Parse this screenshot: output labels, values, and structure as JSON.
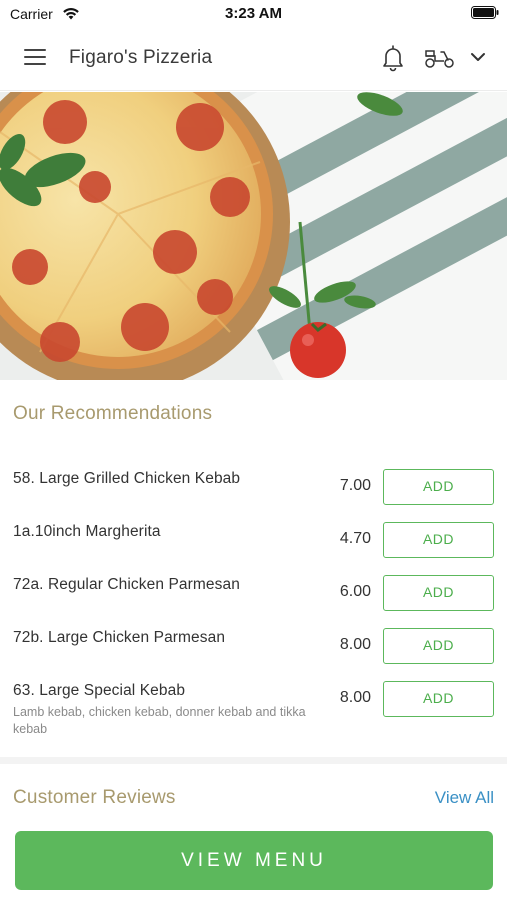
{
  "status_bar": {
    "carrier": "Carrier",
    "time": "3:23 AM"
  },
  "header": {
    "title": "Figaro's Pizzeria",
    "icons": [
      "menu-icon",
      "bell-icon",
      "scooter-icon",
      "chevron-down-icon"
    ]
  },
  "recommendations": {
    "title": "Our Recommendations",
    "add_label": "ADD",
    "items": [
      {
        "name": "58. Large Grilled Chicken Kebab",
        "price": "7.00",
        "description": ""
      },
      {
        "name": "1a.10inch Margherita",
        "price": "4.70",
        "description": ""
      },
      {
        "name": "72a. Regular Chicken Parmesan",
        "price": "6.00",
        "description": ""
      },
      {
        "name": "72b. Large Chicken Parmesan",
        "price": "8.00",
        "description": ""
      },
      {
        "name": "63. Large Special Kebab",
        "price": "8.00",
        "description": "Lamb kebab, chicken kebab, donner kebab and tikka kebab"
      }
    ]
  },
  "reviews": {
    "title": "Customer Reviews",
    "view_all_label": "View All"
  },
  "footer": {
    "view_menu_label": "VIEW MENU"
  },
  "colors": {
    "accent_green": "#5cb85c",
    "section_title": "#a89a6e",
    "link_blue": "#3a90c5"
  }
}
